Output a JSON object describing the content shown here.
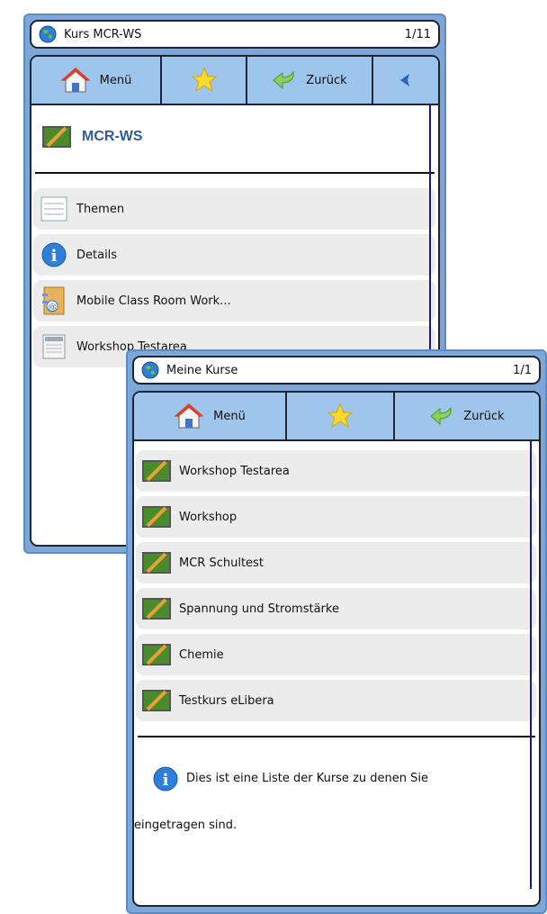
{
  "back_window": {
    "title": "Kurs MCR-WS",
    "counter": "1/11",
    "tabs": {
      "menu": "Menü",
      "back": "Zurück"
    },
    "course_title": "MCR-WS",
    "items": [
      {
        "label": "Themen",
        "icon": "list-icon"
      },
      {
        "label": "Details",
        "icon": "info-icon"
      },
      {
        "label": "Mobile Class Room Work...",
        "icon": "contact-book-icon"
      },
      {
        "label": "Workshop Testarea",
        "icon": "document-icon"
      }
    ]
  },
  "front_window": {
    "title": "Meine Kurse",
    "counter": "1/1",
    "tabs": {
      "menu": "Menü",
      "back": "Zurück"
    },
    "courses": [
      "Workshop Testarea",
      "Workshop",
      "MCR Schultest",
      "Spannung und Stromstärke",
      "Chemie",
      "Testkurs eLibera"
    ],
    "info_line1": "Dies ist eine Liste der Kurse zu denen Sie",
    "info_line2": "eingetragen sind."
  },
  "colors": {
    "frame": "#7da7d6",
    "tab": "#9ec6ec",
    "course_title": "#2e5e96",
    "item_bg": "#ececec"
  }
}
